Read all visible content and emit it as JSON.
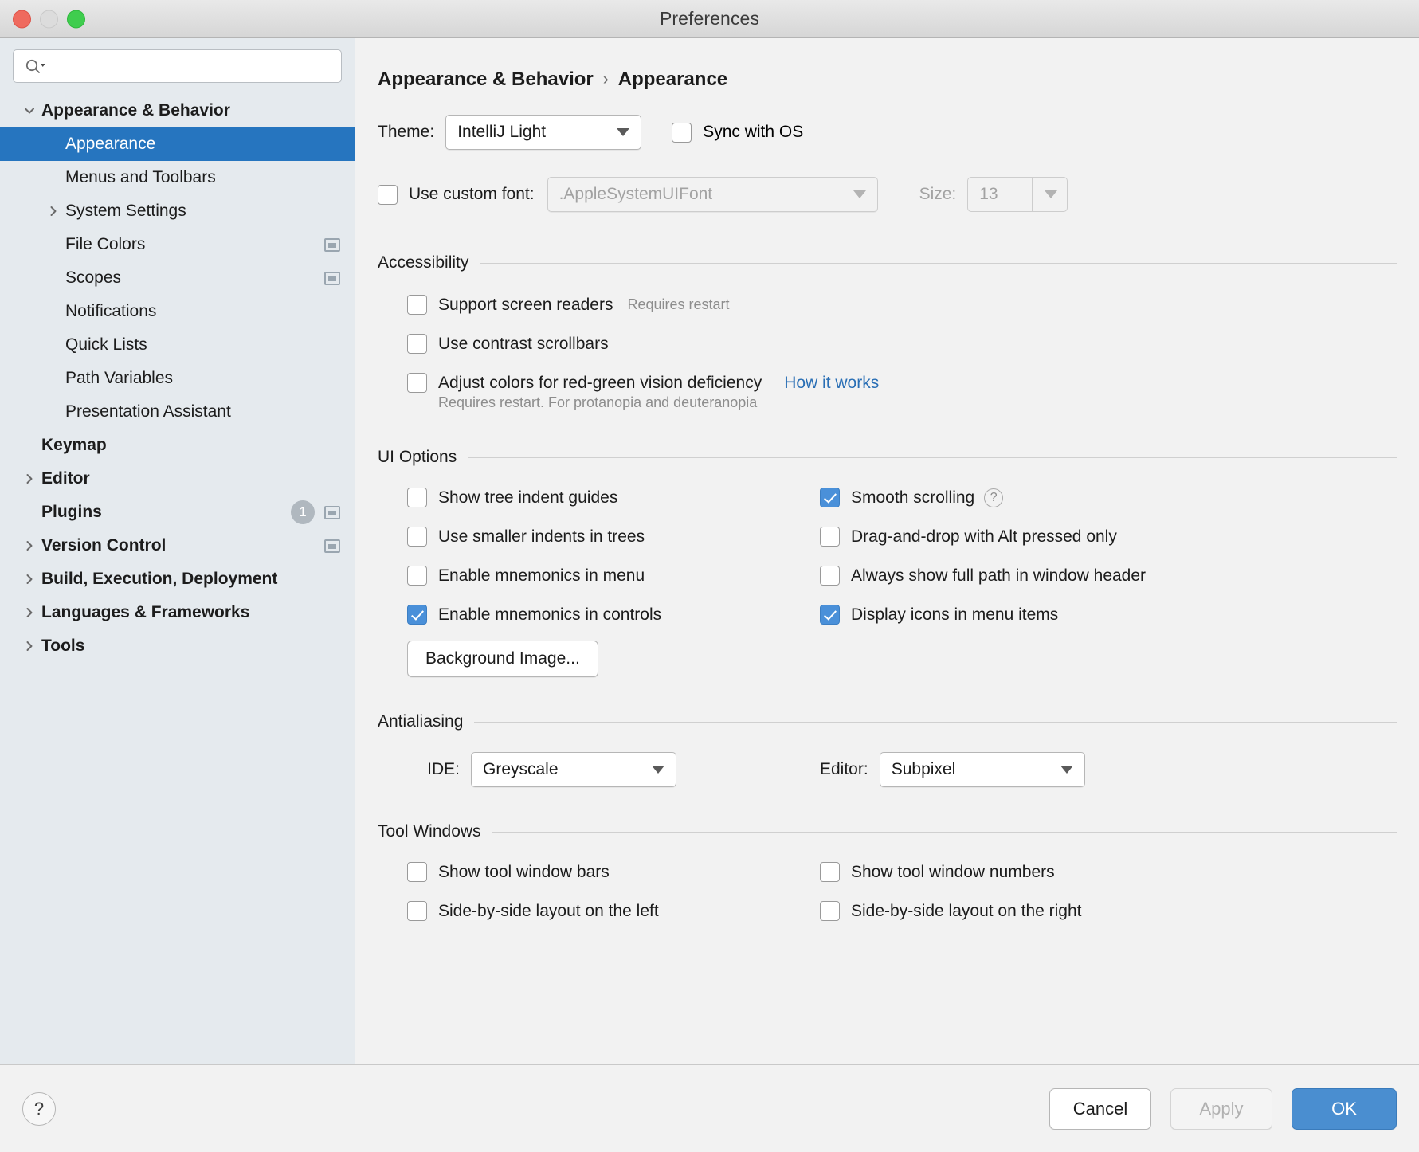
{
  "window": {
    "title": "Preferences",
    "traffic_lights": [
      "close",
      "minimize",
      "maximize"
    ]
  },
  "search": {
    "value": "",
    "placeholder": ""
  },
  "sidebar": {
    "items": [
      {
        "label": "Appearance & Behavior",
        "bold": true,
        "indent": 0,
        "arrow": "down",
        "selected": false,
        "badge": null,
        "project_icon": false
      },
      {
        "label": "Appearance",
        "bold": false,
        "indent": 1,
        "arrow": "none",
        "selected": true,
        "badge": null,
        "project_icon": false
      },
      {
        "label": "Menus and Toolbars",
        "bold": false,
        "indent": 1,
        "arrow": "none",
        "selected": false,
        "badge": null,
        "project_icon": false
      },
      {
        "label": "System Settings",
        "bold": false,
        "indent": 1,
        "arrow": "right",
        "selected": false,
        "badge": null,
        "project_icon": false
      },
      {
        "label": "File Colors",
        "bold": false,
        "indent": 1,
        "arrow": "none",
        "selected": false,
        "badge": null,
        "project_icon": true
      },
      {
        "label": "Scopes",
        "bold": false,
        "indent": 1,
        "arrow": "none",
        "selected": false,
        "badge": null,
        "project_icon": true
      },
      {
        "label": "Notifications",
        "bold": false,
        "indent": 1,
        "arrow": "none",
        "selected": false,
        "badge": null,
        "project_icon": false
      },
      {
        "label": "Quick Lists",
        "bold": false,
        "indent": 1,
        "arrow": "none",
        "selected": false,
        "badge": null,
        "project_icon": false
      },
      {
        "label": "Path Variables",
        "bold": false,
        "indent": 1,
        "arrow": "none",
        "selected": false,
        "badge": null,
        "project_icon": false
      },
      {
        "label": "Presentation Assistant",
        "bold": false,
        "indent": 1,
        "arrow": "none",
        "selected": false,
        "badge": null,
        "project_icon": false
      },
      {
        "label": "Keymap",
        "bold": true,
        "indent": 0,
        "arrow": "none",
        "selected": false,
        "badge": null,
        "project_icon": false
      },
      {
        "label": "Editor",
        "bold": true,
        "indent": 0,
        "arrow": "right",
        "selected": false,
        "badge": null,
        "project_icon": false
      },
      {
        "label": "Plugins",
        "bold": true,
        "indent": 0,
        "arrow": "none",
        "selected": false,
        "badge": "1",
        "project_icon": true
      },
      {
        "label": "Version Control",
        "bold": true,
        "indent": 0,
        "arrow": "right",
        "selected": false,
        "badge": null,
        "project_icon": true
      },
      {
        "label": "Build, Execution, Deployment",
        "bold": true,
        "indent": 0,
        "arrow": "right",
        "selected": false,
        "badge": null,
        "project_icon": false
      },
      {
        "label": "Languages & Frameworks",
        "bold": true,
        "indent": 0,
        "arrow": "right",
        "selected": false,
        "badge": null,
        "project_icon": false
      },
      {
        "label": "Tools",
        "bold": true,
        "indent": 0,
        "arrow": "right",
        "selected": false,
        "badge": null,
        "project_icon": false
      }
    ]
  },
  "main": {
    "breadcrumb": {
      "parent": "Appearance & Behavior",
      "separator": "›",
      "current": "Appearance"
    },
    "theme": {
      "label": "Theme:",
      "value": "IntelliJ Light",
      "sync_label": "Sync with OS",
      "sync_checked": false
    },
    "custom_font": {
      "label": "Use custom font:",
      "checked": false,
      "value": ".AppleSystemUIFont",
      "size_label": "Size:",
      "size_value": "13",
      "disabled": true
    },
    "accessibility": {
      "title": "Accessibility",
      "options": [
        {
          "label": "Support screen readers",
          "checked": false,
          "hint": "Requires restart"
        },
        {
          "label": "Use contrast scrollbars",
          "checked": false,
          "hint": ""
        },
        {
          "label": "Adjust colors for red-green vision deficiency",
          "checked": false,
          "link": "How it works"
        }
      ],
      "sub_hint": "Requires restart. For protanopia and deuteranopia"
    },
    "ui_options": {
      "title": "UI Options",
      "left": [
        {
          "label": "Show tree indent guides",
          "checked": false
        },
        {
          "label": "Use smaller indents in trees",
          "checked": false
        },
        {
          "label": "Enable mnemonics in menu",
          "checked": false
        },
        {
          "label": "Enable mnemonics in controls",
          "checked": true
        }
      ],
      "right": [
        {
          "label": "Smooth scrolling",
          "checked": true,
          "help": "?"
        },
        {
          "label": "Drag-and-drop with Alt pressed only",
          "checked": false
        },
        {
          "label": "Always show full path in window header",
          "checked": false
        },
        {
          "label": "Display icons in menu items",
          "checked": true
        }
      ],
      "background_image_button": "Background Image..."
    },
    "antialiasing": {
      "title": "Antialiasing",
      "ide_label": "IDE:",
      "ide_value": "Greyscale",
      "editor_label": "Editor:",
      "editor_value": "Subpixel"
    },
    "tool_windows": {
      "title": "Tool Windows",
      "left": [
        {
          "label": "Show tool window bars",
          "checked": false
        },
        {
          "label": "Side-by-side layout on the left",
          "checked": false
        }
      ],
      "right": [
        {
          "label": "Show tool window numbers",
          "checked": false
        },
        {
          "label": "Side-by-side layout on the right",
          "checked": false
        }
      ]
    }
  },
  "footer": {
    "help": "?",
    "cancel": "Cancel",
    "apply": "Apply",
    "ok": "OK"
  },
  "colors": {
    "selection_blue": "#2675bf",
    "checkbox_blue": "#4a90d9",
    "primary_button": "#4a8ed0",
    "link_blue": "#2a6fb5",
    "sidebar_bg": "#e5eaee",
    "panel_bg": "#f2f2f2"
  }
}
